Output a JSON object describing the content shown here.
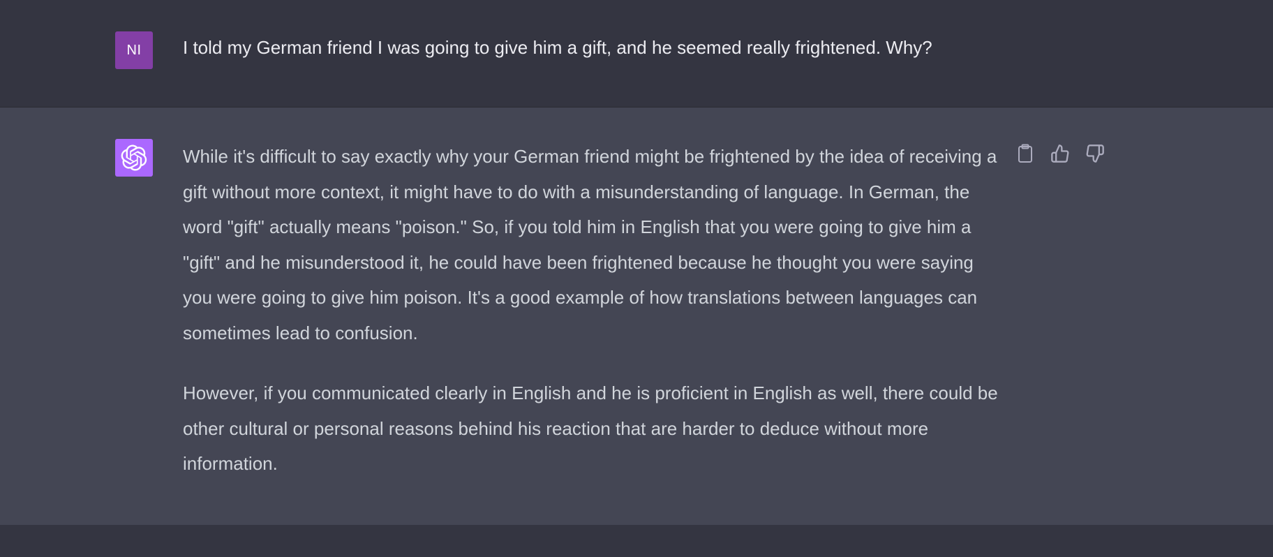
{
  "user_message": {
    "avatar_initials": "NI",
    "text": "I told my German friend I was going to give him a gift, and he seemed really frightened. Why?"
  },
  "assistant_message": {
    "avatar_icon": "openai-logo-icon",
    "paragraphs": [
      "While it's difficult to say exactly why your German friend might be frightened by the idea of receiving a gift without more context, it might have to do with a misunderstanding of language. In German, the word \"gift\" actually means \"poison.\" So, if you told him in English that you were going to give him a \"gift\" and he misunderstood it, he could have been frightened because he thought you were saying you were going to give him poison. It's a good example of how translations between languages can sometimes lead to confusion.",
      "However, if you communicated clearly in English and he is proficient in English as well, there could be other cultural or personal reasons behind his reaction that are harder to deduce without more information."
    ],
    "actions": [
      {
        "icon": "clipboard-icon"
      },
      {
        "icon": "thumbs-up-icon"
      },
      {
        "icon": "thumbs-down-icon"
      }
    ]
  },
  "colors": {
    "page_bg": "#343541",
    "assistant_bg": "#444654",
    "user_avatar": "#833fa6",
    "assistant_avatar": "#ab68ff",
    "text_primary": "#ececf1",
    "text_secondary": "#d1d5db",
    "icon": "#acacbe"
  }
}
